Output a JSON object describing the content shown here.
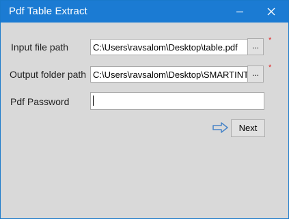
{
  "window": {
    "title": "Pdf Table Extract",
    "minimize_icon": "minimize-icon",
    "close_icon": "close-icon"
  },
  "form": {
    "input_label": "Input file path",
    "input_value": "C:\\Users\\ravsalom\\Desktop\\table.pdf",
    "input_browse": "...",
    "output_label": "Output folder path",
    "output_value": "C:\\Users\\ravsalom\\Desktop\\SMARTINT",
    "output_browse": "...",
    "password_label": "Pdf Password",
    "password_value": "",
    "required_mark": "*"
  },
  "actions": {
    "next_label": "Next",
    "next_icon": "arrow-right-icon"
  },
  "colors": {
    "titlebar": "#1b7bd3",
    "window_bg": "#d9d9d9",
    "required": "#e02020",
    "arrow": "#4a86c8"
  }
}
